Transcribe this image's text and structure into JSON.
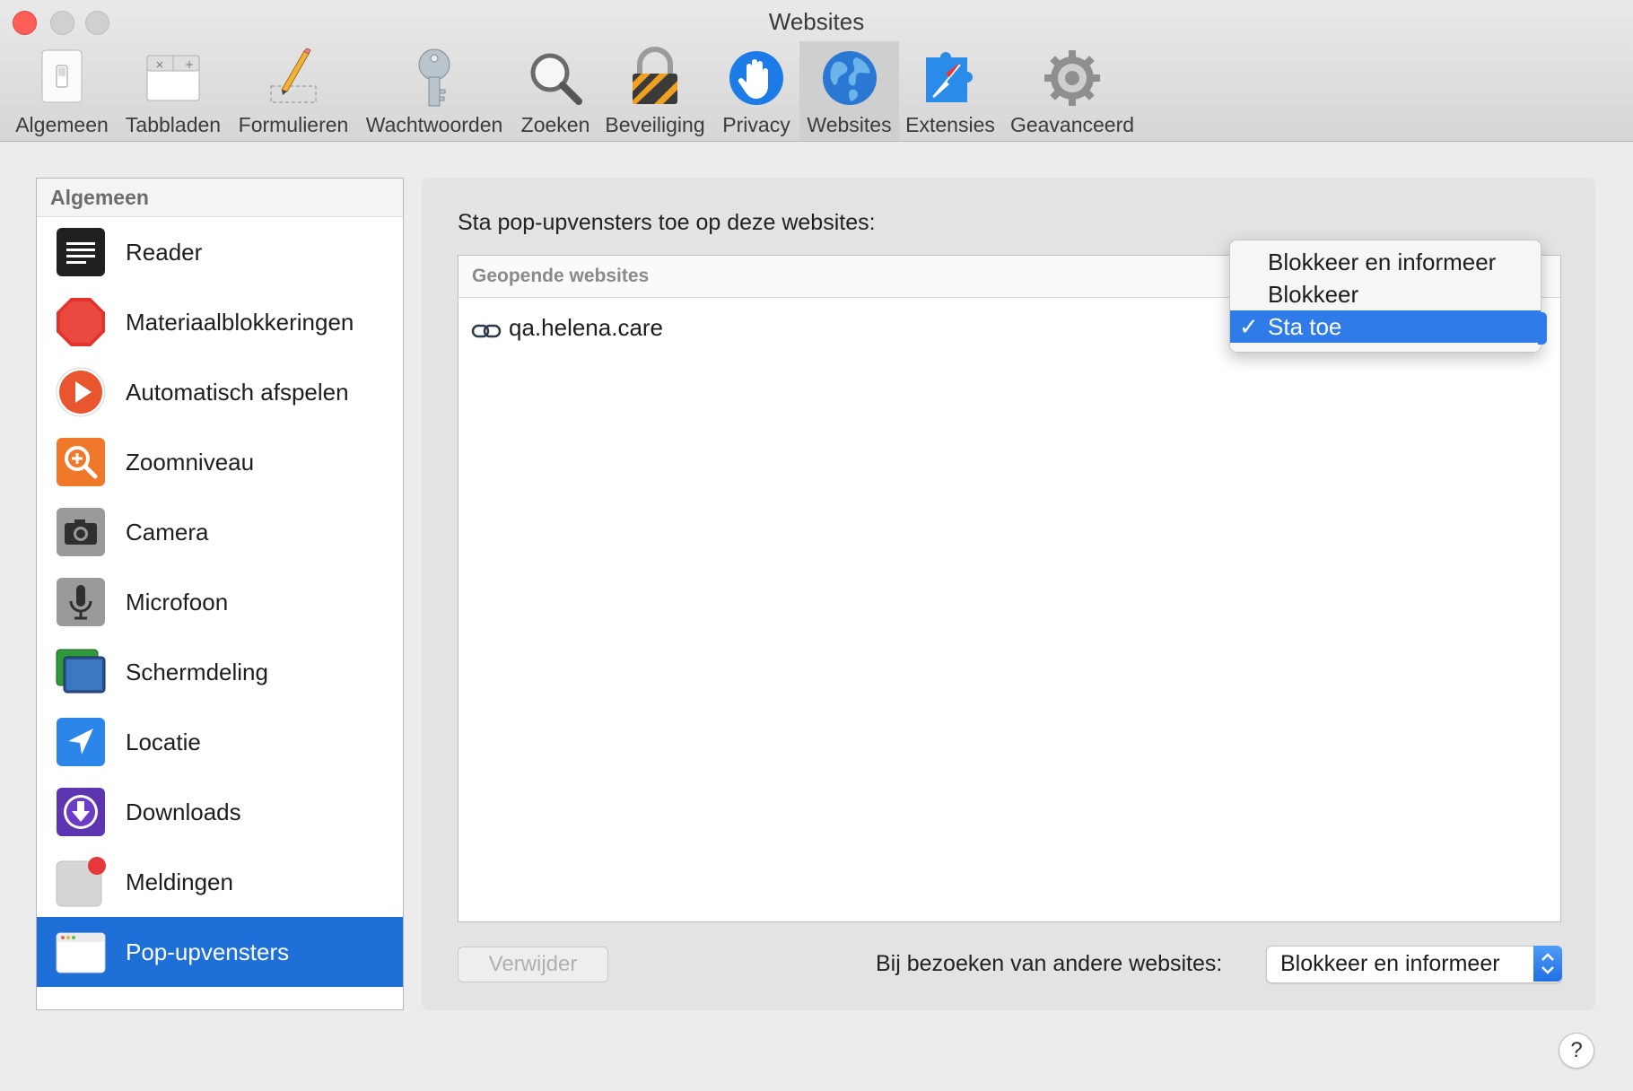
{
  "window": {
    "title": "Websites"
  },
  "toolbar": {
    "items": [
      {
        "label": "Algemeen"
      },
      {
        "label": "Tabbladen"
      },
      {
        "label": "Formulieren"
      },
      {
        "label": "Wachtwoorden"
      },
      {
        "label": "Zoeken"
      },
      {
        "label": "Beveiliging"
      },
      {
        "label": "Privacy"
      },
      {
        "label": "Websites",
        "active": true
      },
      {
        "label": "Extensies"
      },
      {
        "label": "Geavanceerd"
      }
    ]
  },
  "sidebar": {
    "header": "Algemeen",
    "items": [
      {
        "label": "Reader",
        "icon": "reader-icon"
      },
      {
        "label": "Materiaalblokkeringen",
        "icon": "stop-sign-icon"
      },
      {
        "label": "Automatisch afspelen",
        "icon": "play-icon"
      },
      {
        "label": "Zoomniveau",
        "icon": "zoom-icon"
      },
      {
        "label": "Camera",
        "icon": "camera-icon"
      },
      {
        "label": "Microfoon",
        "icon": "microphone-icon"
      },
      {
        "label": "Schermdeling",
        "icon": "screen-sharing-icon"
      },
      {
        "label": "Locatie",
        "icon": "location-icon"
      },
      {
        "label": "Downloads",
        "icon": "download-icon"
      },
      {
        "label": "Meldingen",
        "icon": "notification-icon"
      },
      {
        "label": "Pop-upvensters",
        "icon": "popup-window-icon",
        "selected": true
      }
    ]
  },
  "main": {
    "prompt": "Sta pop-upvensters toe op deze websites:",
    "table_header": "Geopende websites",
    "sites": [
      {
        "host": "qa.helena.care",
        "setting": "Sta toe"
      }
    ],
    "remove_label": "Verwijder",
    "other_label": "Bij bezoeken van andere websites:",
    "other_value": "Blokkeer en informeer"
  },
  "popup_menu": {
    "options": [
      "Blokkeer en informeer",
      "Blokkeer",
      "Sta toe"
    ],
    "selected": "Sta toe",
    "check": "✓"
  },
  "help": {
    "label": "?"
  },
  "colors": {
    "accent": "#1f6fd8",
    "menu_highlight": "#2f7ce8",
    "close": "#fe5f57"
  }
}
